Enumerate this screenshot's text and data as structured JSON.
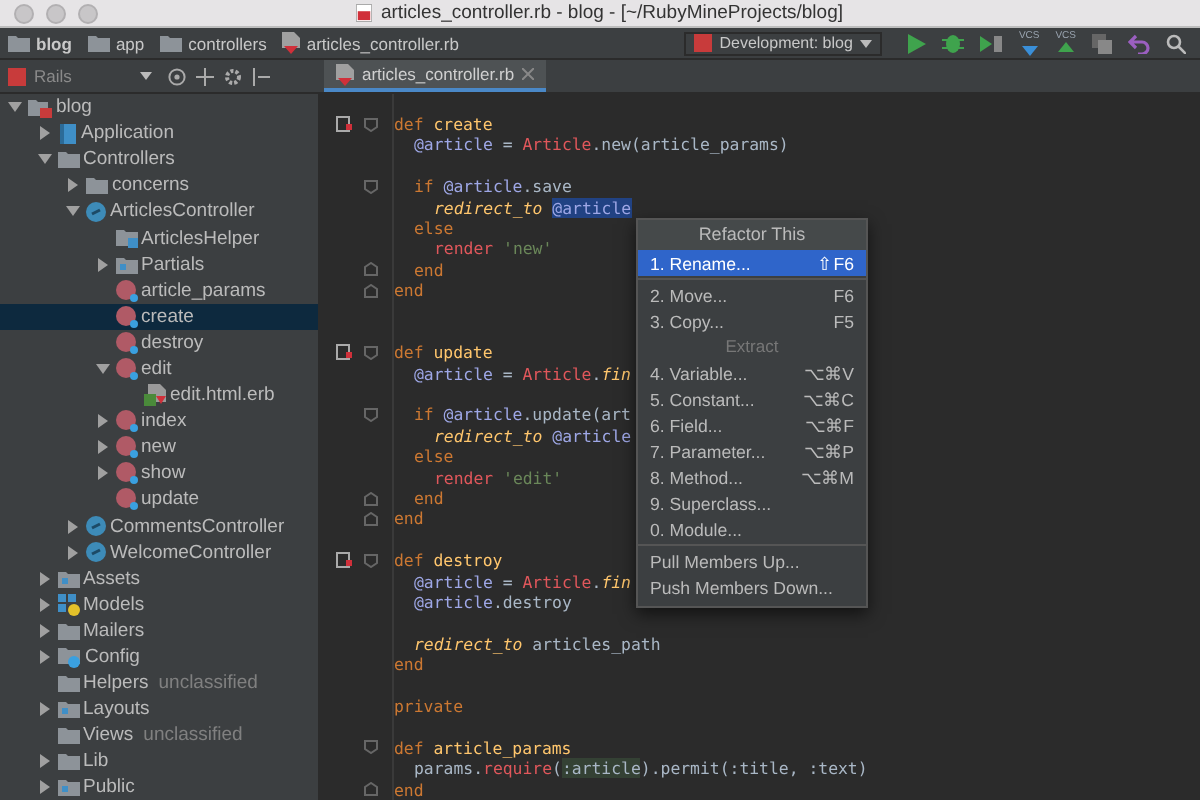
{
  "window": {
    "title": "articles_controller.rb - blog - [~/RubyMineProjects/blog]"
  },
  "breadcrumbs": [
    {
      "label": "blog",
      "kind": "folder"
    },
    {
      "label": "app",
      "kind": "folder"
    },
    {
      "label": "controllers",
      "kind": "folder"
    },
    {
      "label": "articles_controller.rb",
      "kind": "file"
    }
  ],
  "run_config": {
    "label": "Development: blog"
  },
  "vcs_buttons": [
    {
      "label": "VCS",
      "kind": "update"
    },
    {
      "label": "VCS",
      "kind": "commit"
    }
  ],
  "project_view": {
    "label": "Rails"
  },
  "editor_tabs": [
    {
      "label": "articles_controller.rb",
      "selected": true
    }
  ],
  "tree": [
    {
      "label": "blog",
      "kind": "project",
      "expanded": true,
      "selected": false,
      "children": [
        {
          "label": "Application",
          "kind": "module",
          "expanded": false,
          "selected": false
        },
        {
          "label": "Controllers",
          "kind": "folder",
          "expanded": true,
          "selected": false,
          "children": [
            {
              "label": "concerns",
              "kind": "folder",
              "expanded": false,
              "selected": false
            },
            {
              "label": "ArticlesController",
              "kind": "class",
              "expanded": true,
              "selected": false,
              "children": [
                {
                  "label": "ArticlesHelper",
                  "kind": "helper",
                  "selected": false
                },
                {
                  "label": "Partials",
                  "kind": "bluefolder",
                  "expanded": false,
                  "selected": false
                },
                {
                  "label": "article_params",
                  "kind": "method",
                  "selected": false
                },
                {
                  "label": "create",
                  "kind": "method",
                  "selected": true
                },
                {
                  "label": "destroy",
                  "kind": "method",
                  "selected": false
                },
                {
                  "label": "edit",
                  "kind": "method",
                  "expanded": true,
                  "selected": false,
                  "children": [
                    {
                      "label": "edit.html.erb",
                      "kind": "erb",
                      "selected": false
                    }
                  ]
                },
                {
                  "label": "index",
                  "kind": "method",
                  "expanded": false,
                  "selected": false
                },
                {
                  "label": "new",
                  "kind": "method",
                  "expanded": false,
                  "selected": false
                },
                {
                  "label": "show",
                  "kind": "method",
                  "expanded": false,
                  "selected": false
                },
                {
                  "label": "update",
                  "kind": "method",
                  "selected": false
                }
              ]
            },
            {
              "label": "CommentsController",
              "kind": "class",
              "expanded": false,
              "selected": false
            },
            {
              "label": "WelcomeController",
              "kind": "class",
              "expanded": false,
              "selected": false
            }
          ]
        },
        {
          "label": "Assets",
          "kind": "bluefolder",
          "expanded": false,
          "selected": false
        },
        {
          "label": "Models",
          "kind": "models",
          "expanded": false,
          "selected": false
        },
        {
          "label": "Mailers",
          "kind": "folder",
          "expanded": false,
          "selected": false
        },
        {
          "label": "Config",
          "kind": "config",
          "expanded": false,
          "selected": false
        },
        {
          "label": "Helpers",
          "note": "unclassified",
          "kind": "folder",
          "selected": false
        },
        {
          "label": "Layouts",
          "kind": "bluefolder",
          "expanded": false,
          "selected": false
        },
        {
          "label": "Views",
          "note": "unclassified",
          "kind": "folder",
          "selected": false
        },
        {
          "label": "Lib",
          "kind": "folder",
          "expanded": false,
          "selected": false
        },
        {
          "label": "Public",
          "kind": "bluefolder",
          "expanded": false,
          "selected": false
        }
      ]
    }
  ],
  "code": [
    {
      "kind": "code",
      "marker": true,
      "fold_start": true,
      "tokens": [
        {
          "text": "def ",
          "kind": "keyword"
        },
        {
          "text": "create",
          "kind": "name"
        }
      ],
      "children": [
        {
          "kind": "code",
          "tokens": [
            {
              "text": "@article",
              "kind": "ivar"
            },
            {
              "text": " = ",
              "kind": "plain"
            },
            {
              "text": "Article",
              "kind": "constant"
            },
            {
              "text": ".new(article_params)",
              "kind": "plain"
            }
          ]
        },
        {
          "kind": "blank"
        },
        {
          "kind": "code",
          "fold_start": true,
          "tokens": [
            {
              "text": "if ",
              "kind": "keyword"
            },
            {
              "text": "@article",
              "kind": "ivar"
            },
            {
              "text": ".save",
              "kind": "plain"
            }
          ],
          "children": [
            {
              "kind": "code",
              "tokens": [
                {
                  "text": "redirect_to ",
                  "kind": "call"
                },
                {
                  "text": "@article",
                  "kind": "ivar",
                  "selected": true
                }
              ]
            }
          ]
        },
        {
          "kind": "code",
          "tokens": [
            {
              "text": "else",
              "kind": "keyword"
            }
          ],
          "children": [
            {
              "kind": "code",
              "tokens": [
                {
                  "text": "render ",
                  "kind": "builtin"
                },
                {
                  "text": "'new'",
                  "kind": "string"
                }
              ]
            }
          ]
        },
        {
          "kind": "code",
          "fold_end": true,
          "tokens": [
            {
              "text": "end",
              "kind": "keyword"
            }
          ]
        }
      ]
    },
    {
      "kind": "code",
      "fold_end": true,
      "tokens": [
        {
          "text": "end",
          "kind": "keyword"
        }
      ]
    },
    {
      "kind": "blank"
    },
    {
      "kind": "blank"
    },
    {
      "kind": "code",
      "marker": true,
      "fold_start": true,
      "tokens": [
        {
          "text": "def ",
          "kind": "keyword"
        },
        {
          "text": "update",
          "kind": "name"
        }
      ],
      "children": [
        {
          "kind": "code",
          "tokens": [
            {
              "text": "@article",
              "kind": "ivar"
            },
            {
              "text": " = ",
              "kind": "plain"
            },
            {
              "text": "Article",
              "kind": "constant"
            },
            {
              "text": ".",
              "kind": "plain"
            },
            {
              "text": "fin",
              "kind": "call"
            }
          ]
        },
        {
          "kind": "blank"
        },
        {
          "kind": "code",
          "fold_start": true,
          "tokens": [
            {
              "text": "if ",
              "kind": "keyword"
            },
            {
              "text": "@article",
              "kind": "ivar"
            },
            {
              "text": ".update(art",
              "kind": "plain"
            }
          ],
          "children": [
            {
              "kind": "code",
              "tokens": [
                {
                  "text": "redirect_to ",
                  "kind": "call"
                },
                {
                  "text": "@article",
                  "kind": "ivar"
                }
              ]
            }
          ]
        },
        {
          "kind": "code",
          "tokens": [
            {
              "text": "else",
              "kind": "keyword"
            }
          ],
          "children": [
            {
              "kind": "code",
              "tokens": [
                {
                  "text": "render ",
                  "kind": "builtin"
                },
                {
                  "text": "'edit'",
                  "kind": "string"
                }
              ]
            }
          ]
        },
        {
          "kind": "code",
          "fold_end": true,
          "tokens": [
            {
              "text": "end",
              "kind": "keyword"
            }
          ]
        }
      ]
    },
    {
      "kind": "code",
      "fold_end": true,
      "tokens": [
        {
          "text": "end",
          "kind": "keyword"
        }
      ]
    },
    {
      "kind": "blank"
    },
    {
      "kind": "code",
      "marker": true,
      "fold_start": true,
      "tokens": [
        {
          "text": "def ",
          "kind": "keyword"
        },
        {
          "text": "destroy",
          "kind": "name"
        }
      ],
      "children": [
        {
          "kind": "code",
          "tokens": [
            {
              "text": "@article",
              "kind": "ivar"
            },
            {
              "text": " = ",
              "kind": "plain"
            },
            {
              "text": "Article",
              "kind": "constant"
            },
            {
              "text": ".",
              "kind": "plain"
            },
            {
              "text": "fin",
              "kind": "call"
            }
          ]
        },
        {
          "kind": "code",
          "tokens": [
            {
              "text": "@article",
              "kind": "ivar"
            },
            {
              "text": ".destroy",
              "kind": "plain"
            }
          ]
        },
        {
          "kind": "blank"
        },
        {
          "kind": "code",
          "tokens": [
            {
              "text": "redirect_to",
              "kind": "call"
            },
            {
              "text": " articles_path",
              "kind": "plain"
            }
          ]
        }
      ]
    },
    {
      "kind": "code",
      "tokens": [
        {
          "text": "end",
          "kind": "keyword"
        }
      ]
    },
    {
      "kind": "blank"
    },
    {
      "kind": "code",
      "tokens": [
        {
          "text": "private",
          "kind": "keyword"
        }
      ]
    },
    {
      "kind": "blank"
    },
    {
      "kind": "code",
      "fold_start": true,
      "tokens": [
        {
          "text": "def ",
          "kind": "keyword"
        },
        {
          "text": "article_params",
          "kind": "name"
        }
      ],
      "children": [
        {
          "kind": "code",
          "tokens": [
            {
              "text": "params.",
              "kind": "plain"
            },
            {
              "text": "require",
              "kind": "builtin"
            },
            {
              "text": "(",
              "kind": "plain"
            },
            {
              "text": ":article",
              "kind": "symbol"
            },
            {
              "text": ").permit(:title, :text)",
              "kind": "plain"
            }
          ]
        }
      ]
    },
    {
      "kind": "code",
      "fold_end": true,
      "tokens": [
        {
          "text": "end",
          "kind": "keyword"
        }
      ]
    }
  ],
  "popup": {
    "title": "Refactor This",
    "groups": [
      {
        "items": [
          {
            "label": "1. Rename...",
            "shortcut": "⇧F6",
            "selected": true
          }
        ]
      },
      {
        "items": [
          {
            "label": "2. Move...",
            "shortcut": "F6",
            "selected": false
          },
          {
            "label": "3. Copy...",
            "shortcut": "F5",
            "selected": false
          }
        ]
      },
      {
        "heading": "Extract",
        "items": [
          {
            "label": "4. Variable...",
            "shortcut": "⌥⌘V",
            "selected": false
          },
          {
            "label": "5. Constant...",
            "shortcut": "⌥⌘C",
            "selected": false
          },
          {
            "label": "6. Field...",
            "shortcut": "⌥⌘F",
            "selected": false
          },
          {
            "label": "7. Parameter...",
            "shortcut": "⌥⌘P",
            "selected": false
          },
          {
            "label": "8. Method...",
            "shortcut": "⌥⌘M",
            "selected": false
          },
          {
            "label": "9. Superclass...",
            "selected": false
          },
          {
            "label": "0. Module...",
            "selected": false
          }
        ]
      },
      {
        "items": [
          {
            "label": "Pull Members Up...",
            "selected": false
          },
          {
            "label": "Push Members Down...",
            "selected": false
          }
        ]
      }
    ]
  }
}
